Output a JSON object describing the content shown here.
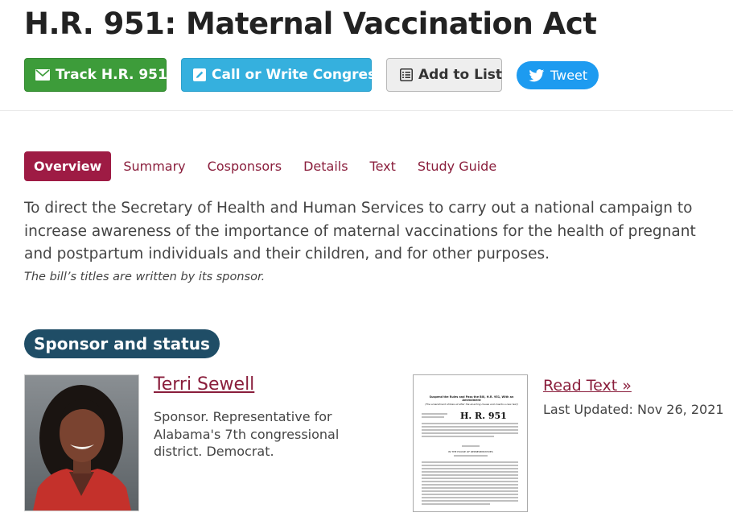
{
  "bill": {
    "title": "H.R. 951: Maternal Vaccination Act"
  },
  "actions": {
    "track": {
      "label": "Track H.R. 951",
      "icon": "envelope-icon"
    },
    "call": {
      "label": "Call or Write Congress",
      "icon": "pencil-square-icon"
    },
    "list": {
      "label": "Add to List",
      "icon": "list-icon"
    },
    "tweet": {
      "label": "Tweet",
      "icon": "twitter-bird-icon"
    }
  },
  "tabs": [
    "Overview",
    "Summary",
    "Cosponsors",
    "Details",
    "Text",
    "Study Guide"
  ],
  "overview": {
    "description": "To direct the Secretary of Health and Human Services to carry out a national campaign to increase awareness of the importance of maternal vaccinations for the health of pregnant and postpartum individuals and their children, and for other purposes.",
    "note": "The bill’s titles are written by its sponsor."
  },
  "sponsor_section": {
    "heading": "Sponsor and status",
    "sponsor": {
      "name": "Terri Sewell",
      "description": "Sponsor. Representative for Alabama's 7th congressional district. Democrat."
    },
    "text_link": "Read Text »",
    "last_updated": "Last Updated: Nov 26, 2021",
    "document_thumbnail": {
      "heading": "Suspend the Rules and Pass the Bill, H.R. 951, With an Amendment",
      "subheading": "(The amendment strikes all after the enacting clause and inserts a new text)",
      "bill_number": "H. R. 951",
      "chamber": "IN THE HOUSE OF REPRESENTATIVES"
    }
  },
  "colors": {
    "track_green": "#3d9c3a",
    "call_blue": "#35b0de",
    "tweet_blue": "#1d9bf0",
    "tab_active": "#9e1b44",
    "link": "#8a1e3c",
    "section_badge": "#1f4d66"
  }
}
